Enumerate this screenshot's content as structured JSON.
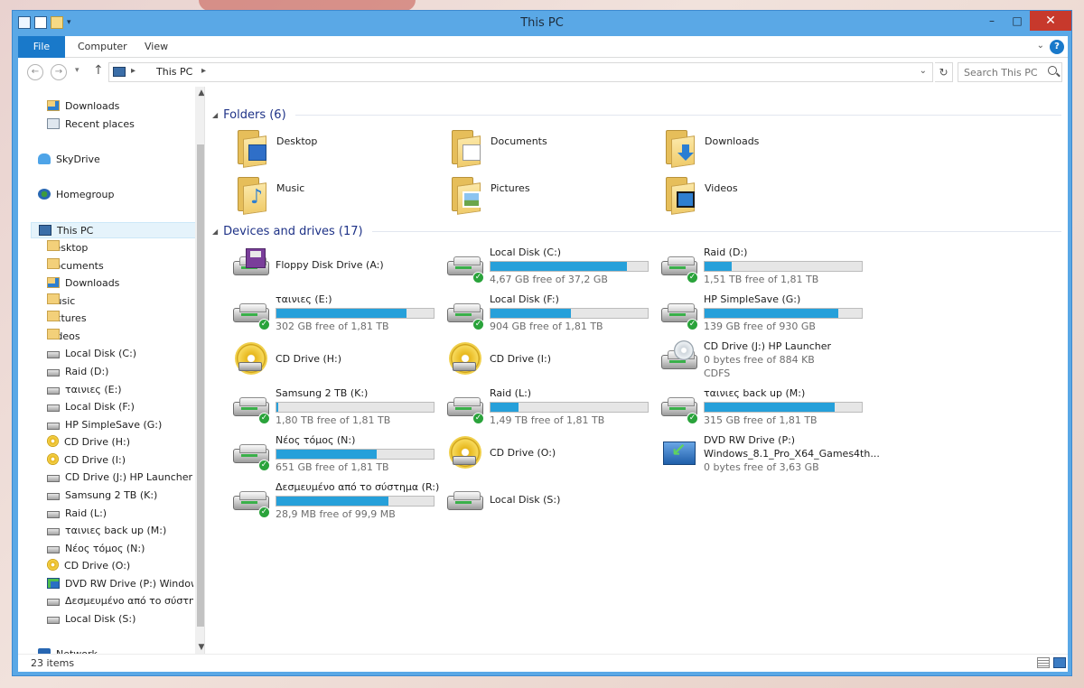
{
  "window": {
    "title": "This PC"
  },
  "ribbon": {
    "tabs": [
      "File",
      "Computer",
      "View"
    ]
  },
  "address": {
    "crumb": "This PC",
    "search_placeholder": "Search This PC"
  },
  "nav": {
    "items": [
      {
        "label": "Downloads",
        "icon": "folderdl"
      },
      {
        "label": "Recent places",
        "icon": "recent"
      },
      {
        "label": "SkyDrive",
        "icon": "cloud"
      },
      {
        "label": "Homegroup",
        "icon": "home"
      },
      {
        "label": "This PC",
        "icon": "pc"
      },
      {
        "label": "Desktop",
        "icon": "folder"
      },
      {
        "label": "Documents",
        "icon": "folder"
      },
      {
        "label": "Downloads",
        "icon": "folderdl"
      },
      {
        "label": "Music",
        "icon": "folder"
      },
      {
        "label": "Pictures",
        "icon": "folder"
      },
      {
        "label": "Videos",
        "icon": "folder"
      },
      {
        "label": "Local Disk (C:)",
        "icon": "disk"
      },
      {
        "label": "Raid (D:)",
        "icon": "disk"
      },
      {
        "label": "ταινιες (E:)",
        "icon": "disk"
      },
      {
        "label": "Local Disk (F:)",
        "icon": "disk"
      },
      {
        "label": "HP SimpleSave (G:)",
        "icon": "disk"
      },
      {
        "label": "CD Drive (H:)",
        "icon": "cd"
      },
      {
        "label": "CD Drive (I:)",
        "icon": "cd"
      },
      {
        "label": "CD Drive (J:) HP Launcher",
        "icon": "disk"
      },
      {
        "label": "Samsung 2 TB (K:)",
        "icon": "disk"
      },
      {
        "label": "Raid (L:)",
        "icon": "disk"
      },
      {
        "label": "ταινιες back up (M:)",
        "icon": "disk"
      },
      {
        "label": "Νέος τόμος (N:)",
        "icon": "disk"
      },
      {
        "label": "CD Drive (O:)",
        "icon": "cd"
      },
      {
        "label": "DVD RW Drive (P:) Windows_",
        "icon": "dvd"
      },
      {
        "label": "Δεσμευμένο από το σύστημ",
        "icon": "disk"
      },
      {
        "label": "Local Disk (S:)",
        "icon": "disk"
      },
      {
        "label": "Network",
        "icon": "net"
      }
    ]
  },
  "groups": {
    "folders": "Folders (6)",
    "devices": "Devices and drives (17)"
  },
  "folders": [
    {
      "label": "Desktop",
      "type": "desktop"
    },
    {
      "label": "Documents",
      "type": "documents"
    },
    {
      "label": "Downloads",
      "type": "downloads"
    },
    {
      "label": "Music",
      "type": "music"
    },
    {
      "label": "Pictures",
      "type": "pictures"
    },
    {
      "label": "Videos",
      "type": "videos"
    }
  ],
  "drives": [
    {
      "name": "Floppy Disk Drive (A:)",
      "kind": "floppy"
    },
    {
      "name": "Local Disk (C:)",
      "kind": "hdd",
      "usage": 0.87,
      "info": "4,67 GB free of 37,2 GB"
    },
    {
      "name": "Raid (D:)",
      "kind": "hdd",
      "usage": 0.17,
      "info": "1,51 TB free of 1,81 TB"
    },
    {
      "name": "ταινιες (E:)",
      "kind": "hdd",
      "usage": 0.83,
      "info": "302 GB free of 1,81 TB"
    },
    {
      "name": "Local Disk (F:)",
      "kind": "hdd",
      "usage": 0.51,
      "info": "904 GB free of 1,81 TB"
    },
    {
      "name": "HP SimpleSave (G:)",
      "kind": "hdd",
      "usage": 0.85,
      "info": "139 GB free of 930 GB"
    },
    {
      "name": "CD Drive (H:)",
      "kind": "cd"
    },
    {
      "name": "CD Drive (I:)",
      "kind": "cd"
    },
    {
      "name": "CD Drive (J:) HP Launcher",
      "kind": "cdj",
      "info": "0 bytes free of 884 KB",
      "info2": "CDFS"
    },
    {
      "name": "Samsung 2 TB (K:)",
      "kind": "hdd",
      "usage": 0.01,
      "info": "1,80 TB free of 1,81 TB"
    },
    {
      "name": "Raid (L:)",
      "kind": "hdd",
      "usage": 0.18,
      "info": "1,49 TB free of 1,81 TB"
    },
    {
      "name": "ταινιες back up (M:)",
      "kind": "hdd",
      "usage": 0.83,
      "info": "315 GB free of 1,81 TB"
    },
    {
      "name": "Νέος τόμος (N:)",
      "kind": "hdd",
      "usage": 0.64,
      "info": "651 GB free of 1,81 TB"
    },
    {
      "name": "CD Drive (O:)",
      "kind": "cd"
    },
    {
      "name": "DVD RW Drive (P:)",
      "kind": "dvd",
      "info": "Windows_8.1_Pro_X64_Games4th...",
      "info2": "0 bytes free of 3,63 GB"
    },
    {
      "name": "Δεσμευμένο από το σύστημα (R:)",
      "kind": "hdd",
      "usage": 0.71,
      "info": "28,9 MB free of 99,9 MB"
    },
    {
      "name": "Local Disk (S:)",
      "kind": "plain"
    }
  ],
  "status": {
    "count": "23 items"
  }
}
